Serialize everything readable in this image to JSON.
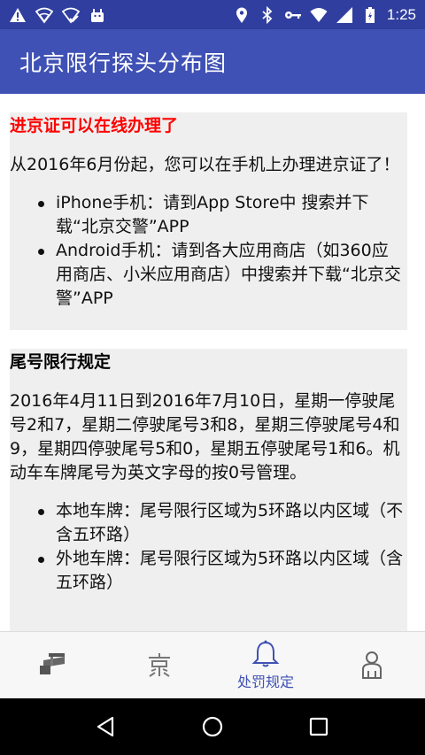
{
  "status_bar": {
    "time": "1:25",
    "icons_left": [
      "warning-icon",
      "wifi-outline-icon",
      "vpn-check-icon",
      "android-icon"
    ],
    "icons_right": [
      "location-icon",
      "bluetooth-icon",
      "key-icon",
      "wifi-icon",
      "signal-icon",
      "battery-icon"
    ]
  },
  "app_bar": {
    "title": "北京限行探头分布图"
  },
  "content": {
    "section1": {
      "title": "进京证可以在线办理了",
      "paragraph": "从2016年6月份起，您可以在手机上办理进京证了！",
      "bullets": [
        "iPhone手机：请到App Store中 搜索并下载“北京交警”APP",
        "Android手机：请到各大应用商店（如360应用商店、小米应用商店）中搜索并下载“北京交警”APP"
      ]
    },
    "section2": {
      "title": "尾号限行规定",
      "paragraph": "2016年4月11日到2016年7月10日，星期一停驶尾号2和7，星期二停驶尾号3和8，星期三停驶尾号4和9，星期四停驶尾号5和0，星期五停驶尾号1和6。机动车车牌尾号为英文字母的按0号管理。",
      "bullets": [
        "本地车牌：尾号限行区域为5环路以内区域（不含五环路）",
        "外地车牌：尾号限行区域为5环路以内区域（含五环路）"
      ]
    }
  },
  "bottom_nav": {
    "items": [
      {
        "icon": "camera-icon",
        "label": ""
      },
      {
        "icon": "jing-character-icon",
        "label": ""
      },
      {
        "icon": "bell-icon",
        "label": "处罚规定"
      },
      {
        "icon": "person-icon",
        "label": ""
      }
    ],
    "accent_color": "#3f51b5"
  },
  "colors": {
    "status_bar": "#303f9f",
    "app_bar": "#3f51b5",
    "section_bg": "#efefef",
    "red_title": "#ff0000"
  }
}
